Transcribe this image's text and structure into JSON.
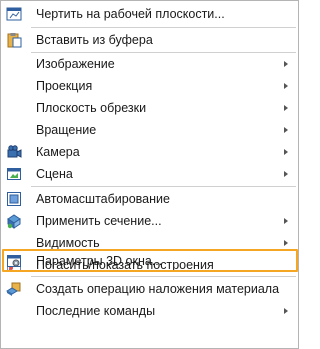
{
  "menu": {
    "items": [
      {
        "label": "Чертить на рабочей плоскости...",
        "icon": "sketch-plane-icon",
        "submenu": false
      },
      {
        "label": "Вставить из буфера",
        "icon": "paste-clipboard-icon",
        "submenu": false
      },
      {
        "label": "Изображение",
        "icon": "",
        "submenu": true
      },
      {
        "label": "Проекция",
        "icon": "",
        "submenu": true
      },
      {
        "label": "Плоскость обрезки",
        "icon": "",
        "submenu": true
      },
      {
        "label": "Вращение",
        "icon": "",
        "submenu": true
      },
      {
        "label": "Камера",
        "icon": "camera-icon",
        "submenu": true
      },
      {
        "label": "Сцена",
        "icon": "scene-icon",
        "submenu": true
      },
      {
        "label": "Автомасштабирование",
        "icon": "autoscale-icon",
        "submenu": false
      },
      {
        "label": "Применить сечение...",
        "icon": "apply-section-icon",
        "submenu": true
      },
      {
        "label": "Видимость",
        "icon": "",
        "submenu": true
      },
      {
        "label": "Погасить/показать построения",
        "icon": "toggle-constructions-icon",
        "submenu": false
      },
      {
        "label": "Параметры 3D окна...",
        "icon": "3d-window-settings-icon",
        "submenu": false,
        "highlighted": true
      },
      {
        "label": "Создать операцию наложения материала",
        "icon": "material-overlay-icon",
        "submenu": false
      },
      {
        "label": "Последние команды",
        "icon": "",
        "submenu": true
      }
    ]
  },
  "colors": {
    "highlight_border": "#f5a623",
    "separator": "#d0d0d0",
    "text": "#1a1a1a"
  }
}
